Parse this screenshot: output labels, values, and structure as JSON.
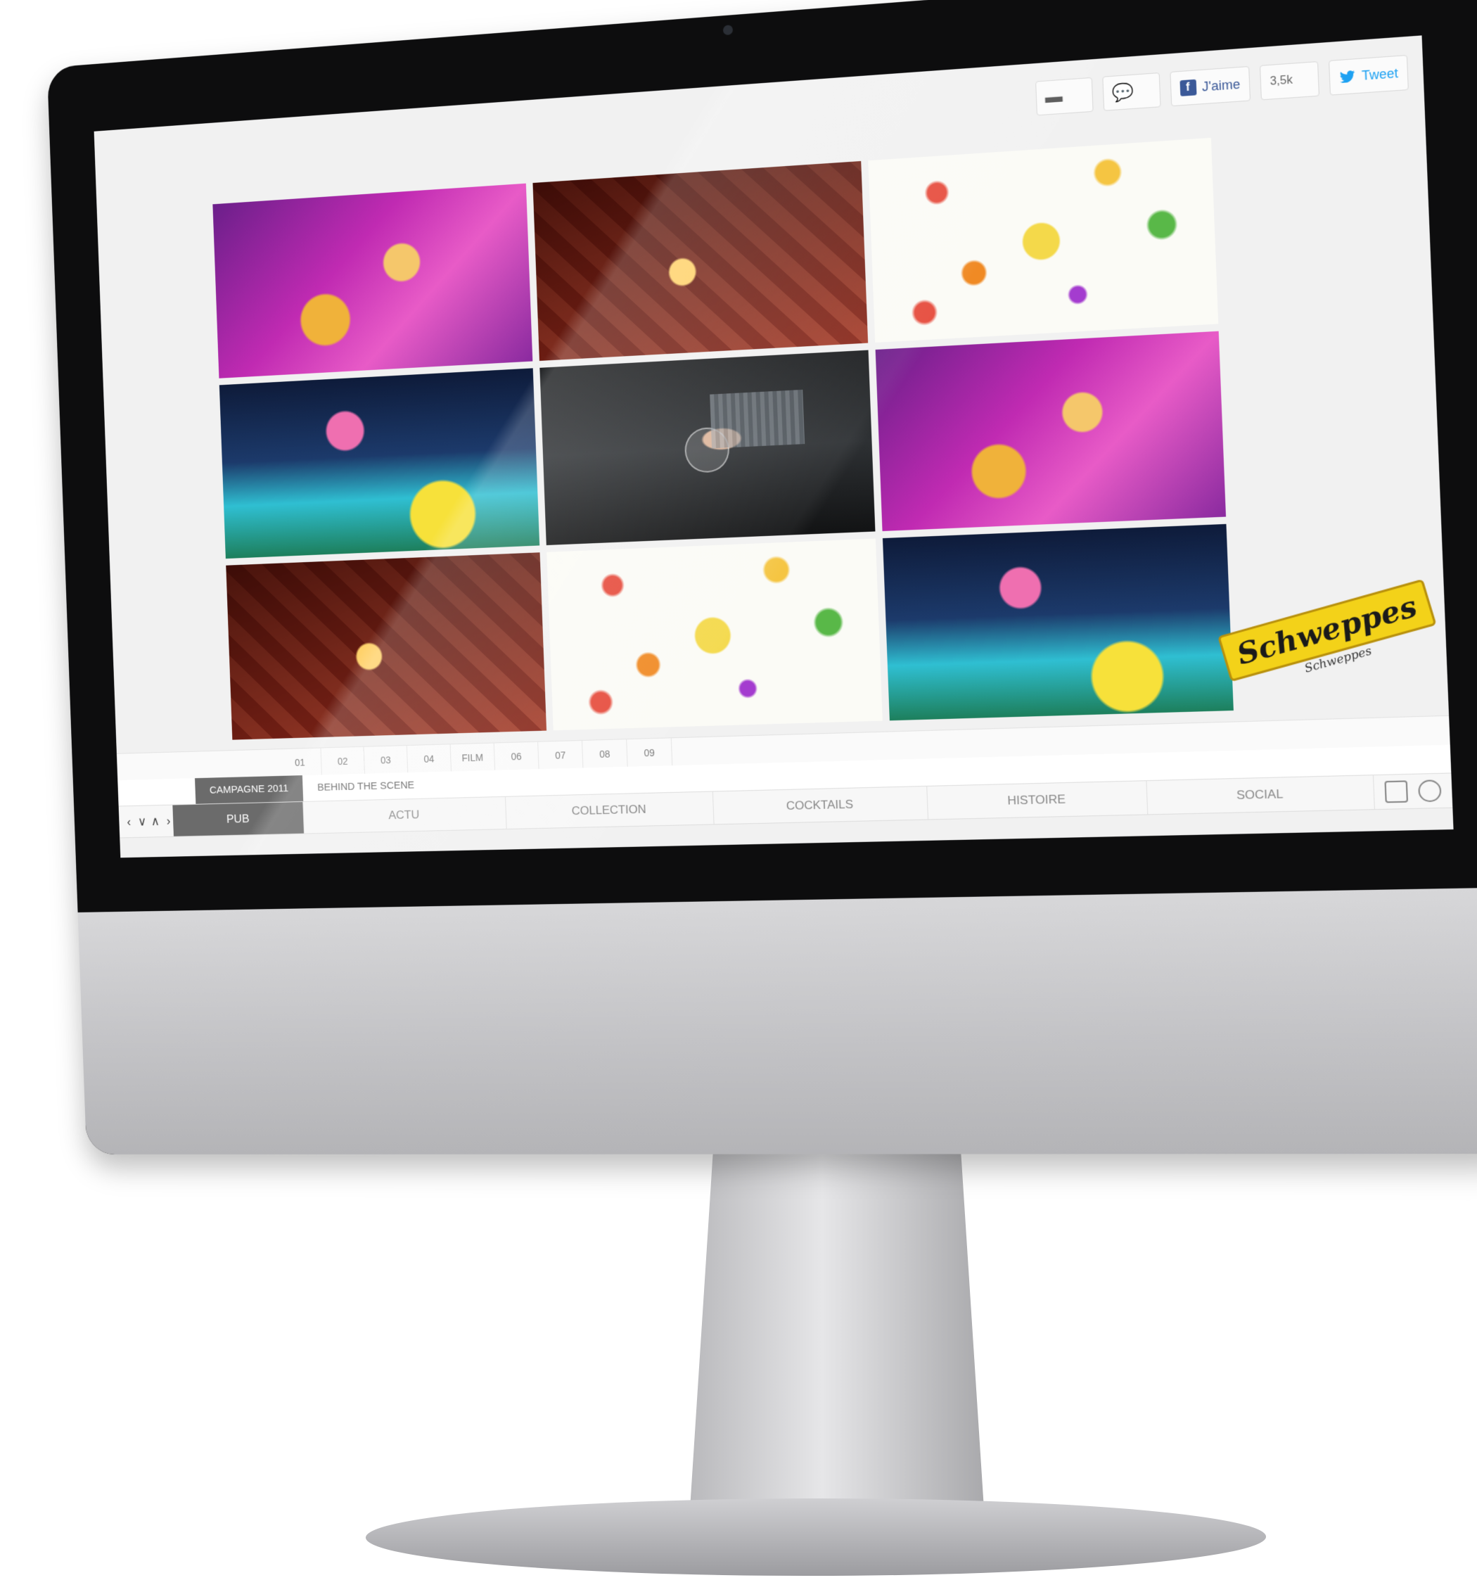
{
  "share_bar": {
    "video_icon": "video-icon",
    "comment_icon": "comment-icon",
    "like_label": "J'aime",
    "like_count": "3,5k",
    "tweet_label": "Tweet"
  },
  "logo": {
    "brand": "Schweppes",
    "signature": "Schweppes"
  },
  "pager": {
    "items": [
      "01",
      "02",
      "03",
      "04",
      "FILM",
      "06",
      "07",
      "08",
      "09"
    ]
  },
  "subtabs": [
    "CAMPAGNE 2011",
    "BEHIND THE SCENE"
  ],
  "nav": {
    "arrows": [
      "‹",
      "∨",
      "∧",
      "›"
    ],
    "items": [
      "PUB",
      "ACTU",
      "COLLECTION",
      "COCKTAILS",
      "HISTOIRE",
      "SOCIAL"
    ],
    "active": "PUB"
  },
  "colors": {
    "nav_active": "#6b6b6b",
    "brand_yellow": "#f3d219",
    "facebook": "#3b5998",
    "twitter": "#1da1f2"
  }
}
